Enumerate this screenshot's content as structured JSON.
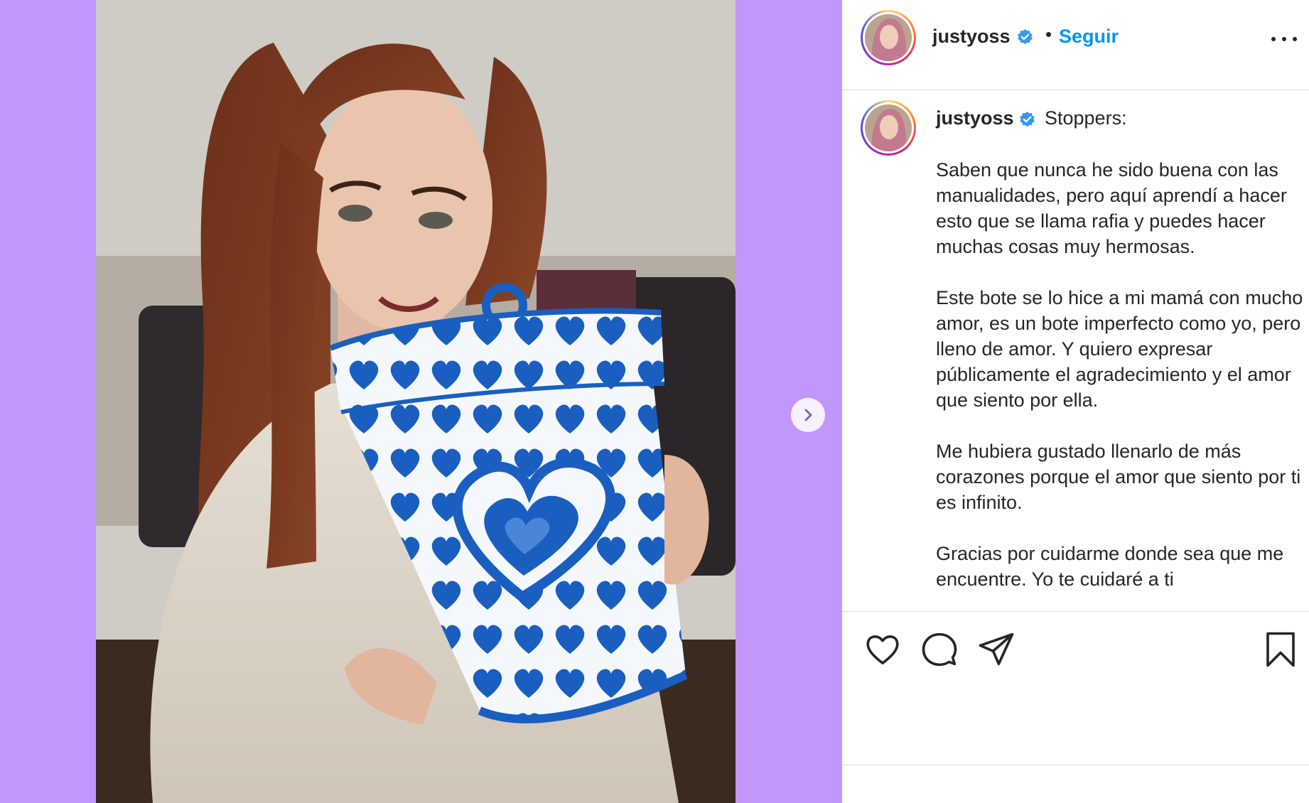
{
  "post": {
    "username": "justyoss",
    "follow_label": "Seguir",
    "separator": "•",
    "caption": {
      "first_line": "Stoppers:",
      "paragraphs": [
        "Saben que nunca he sido buena con las manualidades, pero aquí aprendí a hacer esto que se llama rafia y puedes hacer muchas cosas muy hermosas.",
        "Este bote se lo hice a mi mamá con mucho amor, es un bote imperfecto como yo, pero lleno de amor. Y quiero expresar públicamente el agradecimiento y el amor que siento por ella.",
        "Me hubiera gustado llenarlo de más corazones porque el amor que siento por ti es infinito.",
        "Gracias por cuidarme donde sea que me encuentre. Yo te cuidaré a ti"
      ]
    }
  },
  "icons": {
    "verified": "verified-badge-icon",
    "more": "more-options-icon",
    "next": "chevron-right-icon",
    "like": "heart-icon",
    "comment": "comment-icon",
    "share": "paper-plane-icon",
    "save": "bookmark-icon"
  },
  "colors": {
    "media_background": "#c197fb",
    "link_blue": "#0095f6",
    "verified_blue": "#3897f0",
    "basket_blue": "#1a5fc0",
    "divider": "#dbdbdb"
  }
}
